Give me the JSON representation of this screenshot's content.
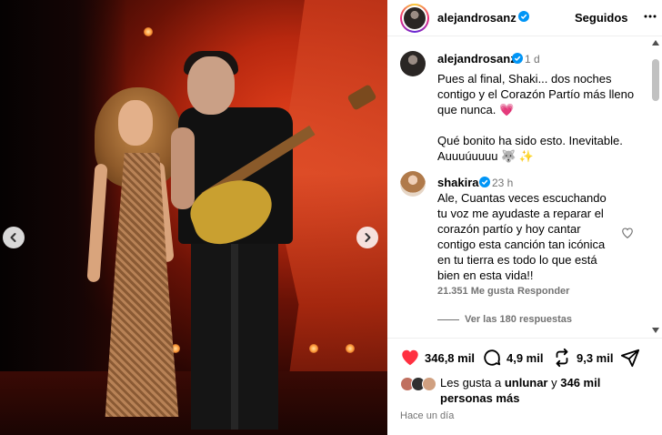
{
  "post": {
    "author": "alejandrosanz",
    "follow_status": "Seguidos",
    "caption": {
      "username": "alejandrosanz",
      "time": "1 d",
      "text": "Pues al final, Shaki... dos noches contigo y el Corazón Partío más lleno que nunca. 💗\n\nQué bonito ha sido esto. Inevitable. Auuuúuuuu 🐺 ✨"
    },
    "comments": [
      {
        "username": "shakira",
        "time": "23 h",
        "text": "Ale, Cuantas veces escuchando tu voz me ayudaste a reparar el corazón partío y hoy cantar contigo esta canción tan icónica en tu tierra es todo lo que está bien en esta vida!!",
        "likes": "21.351 Me gusta",
        "reply_label": "Responder",
        "view_replies": "Ver las 180 respuestas"
      }
    ],
    "actions": {
      "likes_count": "346,8 mil",
      "comments_count": "4,9 mil",
      "shares_count": "9,3 mil"
    },
    "liked_by": {
      "prefix": "Les gusta a ",
      "user": "unlunar",
      "connector": " y ",
      "others": "346 mil personas más"
    },
    "posted": "Hace un día"
  },
  "colors": {
    "like_red": "#ff3040",
    "verified_blue": "#0095f6",
    "secondary_text": "#737373"
  },
  "icons": [
    "more-icon",
    "verified-icon",
    "heart-icon",
    "comment-icon",
    "share-icon",
    "send-icon",
    "chevron-left-icon",
    "chevron-right-icon"
  ]
}
